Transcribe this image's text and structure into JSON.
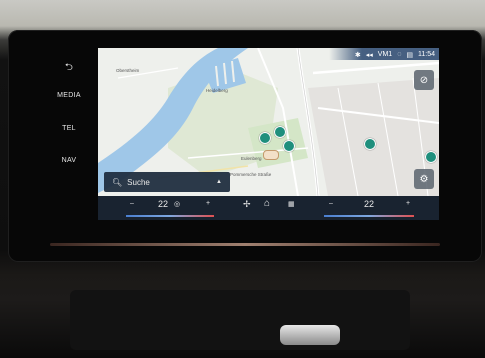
{
  "hardware_buttons": {
    "back": "⮌",
    "media": "MEDIA",
    "tel": "TEL",
    "nav": "NAV"
  },
  "status": {
    "network": "VM1",
    "time": "11:54"
  },
  "map_labels": {
    "area1": "Oberstheim",
    "area2": "Heidelberg",
    "street1": "Pommersche Straße",
    "street2": "Eulenberg"
  },
  "search": {
    "placeholder": "Suche"
  },
  "climate": {
    "left_minus": "–",
    "left_temp": "22",
    "left_plus": "+",
    "right_minus": "–",
    "right_temp": "22",
    "right_plus": "+"
  },
  "colors": {
    "water": "#9fc7e8",
    "poi": "#1f8f7d",
    "bar": "#101a28"
  }
}
